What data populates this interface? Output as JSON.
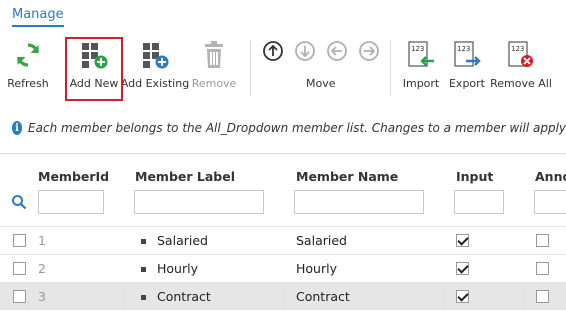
{
  "tabs": {
    "active": "Manage"
  },
  "ribbon": {
    "refresh": "Refresh",
    "add_new": "Add New",
    "add_existing": "Add Existing",
    "remove": "Remove",
    "move": "Move",
    "import": "Import",
    "export": "Export",
    "remove_all": "Remove All",
    "file_badge": "123"
  },
  "info": {
    "icon_glyph": "i",
    "message": "Each member belongs to the All_Dropdown member list. Changes to a member will apply"
  },
  "grid": {
    "columns": [
      "MemberId",
      "Member Label",
      "Member Name",
      "Input",
      "Anno"
    ],
    "rows": [
      {
        "id": "1",
        "label": "Salaried",
        "name": "Salaried",
        "input": true,
        "selected": false
      },
      {
        "id": "2",
        "label": "Hourly",
        "name": "Hourly",
        "input": true,
        "selected": false
      },
      {
        "id": "3",
        "label": "Contract",
        "name": "Contract",
        "input": true,
        "selected": true
      }
    ]
  },
  "colors": {
    "accent": "#2a7bc4",
    "refresh_green": "#3aa344",
    "add_green": "#27a347",
    "highlight_red": "#d21f2a"
  }
}
